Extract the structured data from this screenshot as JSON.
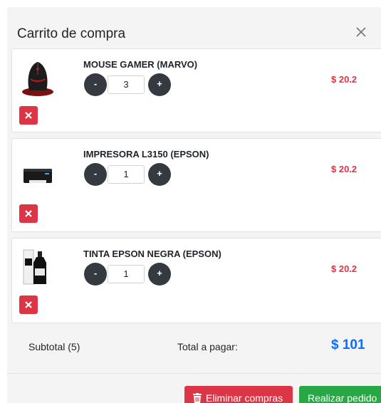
{
  "modal": {
    "title": "Carrito de compra",
    "close_icon": "close-x-icon"
  },
  "cart": {
    "items": [
      {
        "name": "MOUSE GAMER (MARVO)",
        "quantity": "3",
        "price": "$ 20.2",
        "decrement_label": "-",
        "increment_label": "+",
        "image_icon": "gaming-mouse-image"
      },
      {
        "name": "IMPRESORA L3150 (EPSON)",
        "quantity": "1",
        "price": "$ 20.2",
        "decrement_label": "-",
        "increment_label": "+",
        "image_icon": "printer-image"
      },
      {
        "name": "TINTA EPSON NEGRA (EPSON)",
        "quantity": "1",
        "price": "$ 20.2",
        "decrement_label": "-",
        "increment_label": "+",
        "image_icon": "ink-bottle-image"
      }
    ]
  },
  "summary": {
    "subtotal": "Subtotal (5)",
    "total_label": "Total a pagar:",
    "total_value": "$ 101"
  },
  "footer": {
    "clear_label": "Eliminar compras",
    "clear_icon": "trash-icon",
    "order_label": "Realizar pedido"
  },
  "colors": {
    "danger": "#dc3545",
    "success": "#28a745",
    "primary": "#0d6efd",
    "dark": "#343a40"
  }
}
